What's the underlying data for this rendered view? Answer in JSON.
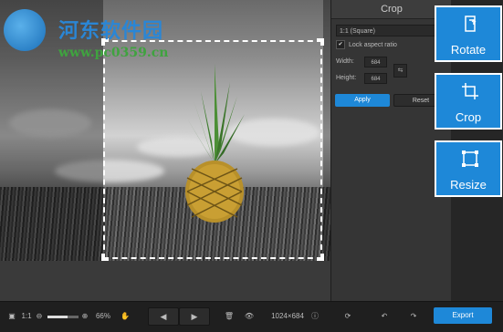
{
  "watermark": {
    "title": "河东软件园",
    "url": "www.pc0359.cn"
  },
  "crop_panel": {
    "title": "Crop",
    "aspect_value": "1:1 (Square)",
    "lock_label": "Lock aspect ratio",
    "lock_checked": "✔",
    "width_label": "Width:",
    "width_value": "684",
    "height_label": "Height:",
    "height_value": "684",
    "apply_label": "Apply",
    "reset_label": "Reset"
  },
  "tools": {
    "rotate_label": "Rotate",
    "crop_label": "Crop",
    "resize_label": "Resize"
  },
  "toolbar": {
    "zoom_ratio_label": "1:1",
    "zoom_percent": "66%",
    "zoom_level": 0.66,
    "dimensions": "1024×684",
    "export_label": "Export"
  },
  "colors": {
    "accent": "#1e88d8"
  }
}
